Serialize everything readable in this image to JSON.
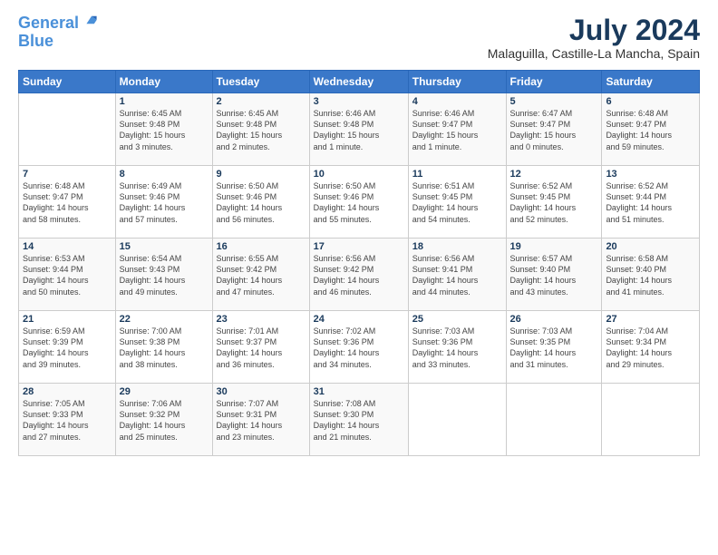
{
  "logo": {
    "line1": "General",
    "line2": "Blue"
  },
  "header": {
    "month_year": "July 2024",
    "location": "Malaguilla, Castille-La Mancha, Spain"
  },
  "days_of_week": [
    "Sunday",
    "Monday",
    "Tuesday",
    "Wednesday",
    "Thursday",
    "Friday",
    "Saturday"
  ],
  "weeks": [
    [
      {
        "day": "",
        "info": ""
      },
      {
        "day": "1",
        "info": "Sunrise: 6:45 AM\nSunset: 9:48 PM\nDaylight: 15 hours\nand 3 minutes."
      },
      {
        "day": "2",
        "info": "Sunrise: 6:45 AM\nSunset: 9:48 PM\nDaylight: 15 hours\nand 2 minutes."
      },
      {
        "day": "3",
        "info": "Sunrise: 6:46 AM\nSunset: 9:48 PM\nDaylight: 15 hours\nand 1 minute."
      },
      {
        "day": "4",
        "info": "Sunrise: 6:46 AM\nSunset: 9:47 PM\nDaylight: 15 hours\nand 1 minute."
      },
      {
        "day": "5",
        "info": "Sunrise: 6:47 AM\nSunset: 9:47 PM\nDaylight: 15 hours\nand 0 minutes."
      },
      {
        "day": "6",
        "info": "Sunrise: 6:48 AM\nSunset: 9:47 PM\nDaylight: 14 hours\nand 59 minutes."
      }
    ],
    [
      {
        "day": "7",
        "info": "Sunrise: 6:48 AM\nSunset: 9:47 PM\nDaylight: 14 hours\nand 58 minutes."
      },
      {
        "day": "8",
        "info": "Sunrise: 6:49 AM\nSunset: 9:46 PM\nDaylight: 14 hours\nand 57 minutes."
      },
      {
        "day": "9",
        "info": "Sunrise: 6:50 AM\nSunset: 9:46 PM\nDaylight: 14 hours\nand 56 minutes."
      },
      {
        "day": "10",
        "info": "Sunrise: 6:50 AM\nSunset: 9:46 PM\nDaylight: 14 hours\nand 55 minutes."
      },
      {
        "day": "11",
        "info": "Sunrise: 6:51 AM\nSunset: 9:45 PM\nDaylight: 14 hours\nand 54 minutes."
      },
      {
        "day": "12",
        "info": "Sunrise: 6:52 AM\nSunset: 9:45 PM\nDaylight: 14 hours\nand 52 minutes."
      },
      {
        "day": "13",
        "info": "Sunrise: 6:52 AM\nSunset: 9:44 PM\nDaylight: 14 hours\nand 51 minutes."
      }
    ],
    [
      {
        "day": "14",
        "info": "Sunrise: 6:53 AM\nSunset: 9:44 PM\nDaylight: 14 hours\nand 50 minutes."
      },
      {
        "day": "15",
        "info": "Sunrise: 6:54 AM\nSunset: 9:43 PM\nDaylight: 14 hours\nand 49 minutes."
      },
      {
        "day": "16",
        "info": "Sunrise: 6:55 AM\nSunset: 9:42 PM\nDaylight: 14 hours\nand 47 minutes."
      },
      {
        "day": "17",
        "info": "Sunrise: 6:56 AM\nSunset: 9:42 PM\nDaylight: 14 hours\nand 46 minutes."
      },
      {
        "day": "18",
        "info": "Sunrise: 6:56 AM\nSunset: 9:41 PM\nDaylight: 14 hours\nand 44 minutes."
      },
      {
        "day": "19",
        "info": "Sunrise: 6:57 AM\nSunset: 9:40 PM\nDaylight: 14 hours\nand 43 minutes."
      },
      {
        "day": "20",
        "info": "Sunrise: 6:58 AM\nSunset: 9:40 PM\nDaylight: 14 hours\nand 41 minutes."
      }
    ],
    [
      {
        "day": "21",
        "info": "Sunrise: 6:59 AM\nSunset: 9:39 PM\nDaylight: 14 hours\nand 39 minutes."
      },
      {
        "day": "22",
        "info": "Sunrise: 7:00 AM\nSunset: 9:38 PM\nDaylight: 14 hours\nand 38 minutes."
      },
      {
        "day": "23",
        "info": "Sunrise: 7:01 AM\nSunset: 9:37 PM\nDaylight: 14 hours\nand 36 minutes."
      },
      {
        "day": "24",
        "info": "Sunrise: 7:02 AM\nSunset: 9:36 PM\nDaylight: 14 hours\nand 34 minutes."
      },
      {
        "day": "25",
        "info": "Sunrise: 7:03 AM\nSunset: 9:36 PM\nDaylight: 14 hours\nand 33 minutes."
      },
      {
        "day": "26",
        "info": "Sunrise: 7:03 AM\nSunset: 9:35 PM\nDaylight: 14 hours\nand 31 minutes."
      },
      {
        "day": "27",
        "info": "Sunrise: 7:04 AM\nSunset: 9:34 PM\nDaylight: 14 hours\nand 29 minutes."
      }
    ],
    [
      {
        "day": "28",
        "info": "Sunrise: 7:05 AM\nSunset: 9:33 PM\nDaylight: 14 hours\nand 27 minutes."
      },
      {
        "day": "29",
        "info": "Sunrise: 7:06 AM\nSunset: 9:32 PM\nDaylight: 14 hours\nand 25 minutes."
      },
      {
        "day": "30",
        "info": "Sunrise: 7:07 AM\nSunset: 9:31 PM\nDaylight: 14 hours\nand 23 minutes."
      },
      {
        "day": "31",
        "info": "Sunrise: 7:08 AM\nSunset: 9:30 PM\nDaylight: 14 hours\nand 21 minutes."
      },
      {
        "day": "",
        "info": ""
      },
      {
        "day": "",
        "info": ""
      },
      {
        "day": "",
        "info": ""
      }
    ]
  ]
}
